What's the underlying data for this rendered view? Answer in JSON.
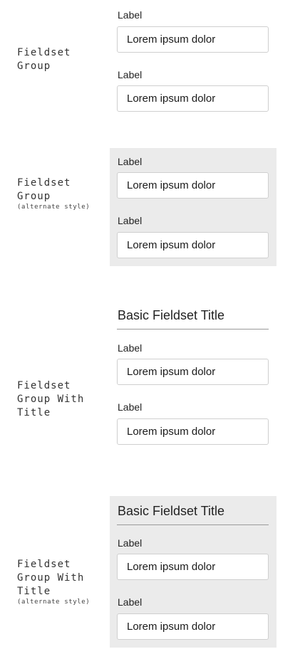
{
  "colors": {
    "alt_panel_bg": "#ebebeb",
    "input_border": "#cfcfcf",
    "title_rule": "#9a9a9a"
  },
  "sections": [
    {
      "name_lines": "Fieldset\nGroup",
      "alt_note": "",
      "title": "",
      "fields": [
        {
          "label": "Label",
          "value": "Lorem ipsum dolor"
        },
        {
          "label": "Label",
          "value": "Lorem ipsum dolor"
        }
      ]
    },
    {
      "name_lines": "Fieldset\nGroup",
      "alt_note": "(alternate style)",
      "title": "",
      "fields": [
        {
          "label": "Label",
          "value": "Lorem ipsum dolor"
        },
        {
          "label": "Label",
          "value": "Lorem ipsum dolor"
        }
      ]
    },
    {
      "name_lines": "Fieldset\nGroup With\nTitle",
      "alt_note": "",
      "title": "Basic Fieldset Title",
      "fields": [
        {
          "label": "Label",
          "value": "Lorem ipsum dolor"
        },
        {
          "label": "Label",
          "value": "Lorem ipsum dolor"
        }
      ]
    },
    {
      "name_lines": "Fieldset\nGroup With\nTitle",
      "alt_note": "(alternate style)",
      "title": "Basic Fieldset Title",
      "fields": [
        {
          "label": "Label",
          "value": "Lorem ipsum dolor"
        },
        {
          "label": "Label",
          "value": "Lorem ipsum dolor"
        }
      ]
    }
  ]
}
